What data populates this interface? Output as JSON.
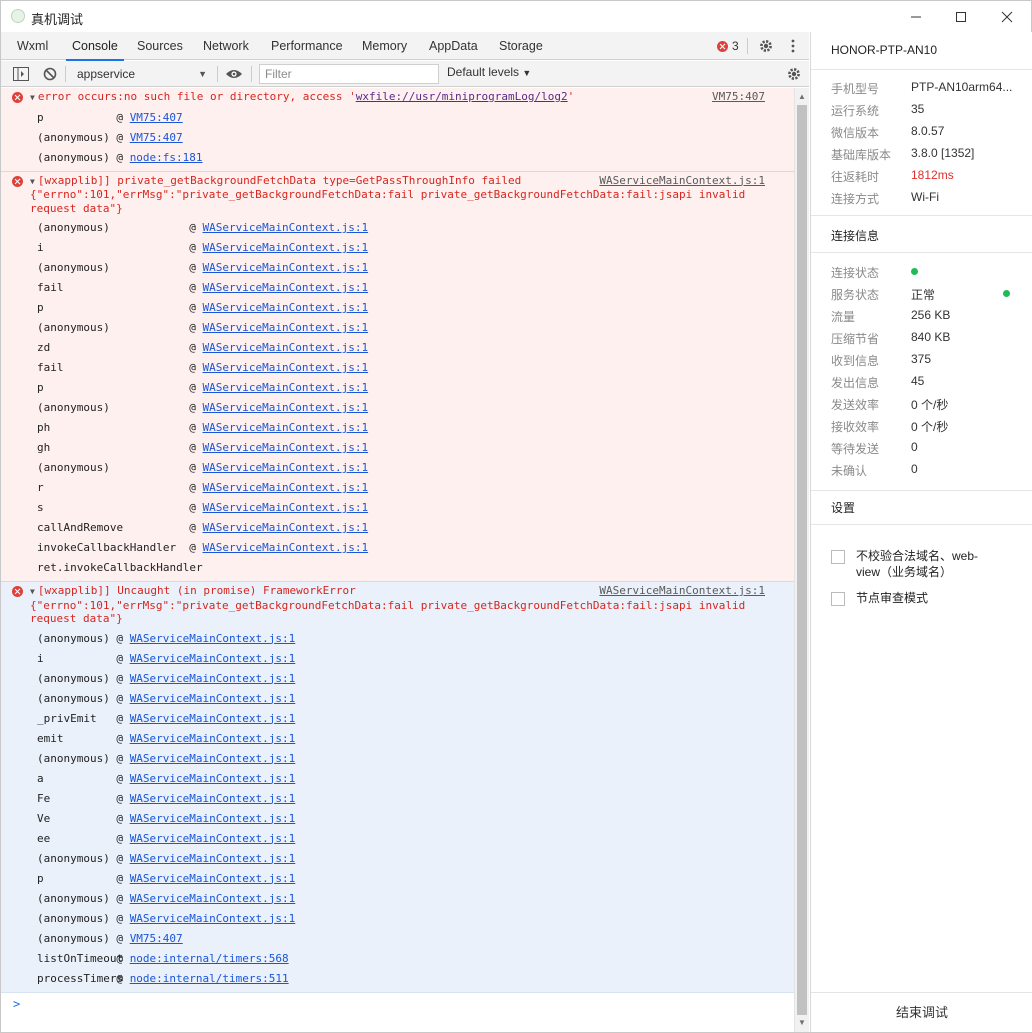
{
  "window": {
    "title": "真机调试"
  },
  "tabs": [
    "Wxml",
    "Console",
    "Sources",
    "Network",
    "Performance",
    "Memory",
    "AppData",
    "Storage"
  ],
  "error_count": "3",
  "toolbar": {
    "context": "appservice",
    "filter_placeholder": "Filter",
    "levels": "Default levels"
  },
  "messages": [
    {
      "type": "error",
      "bg": "red",
      "text_prefix": "error occurs:no such file or directory, access '",
      "text_link": "wxfile://usr/miniprogramLog/log2",
      "text_suffix": "'",
      "source": "VM75:407",
      "frames": [
        {
          "fn": "p",
          "src": "VM75:407"
        },
        {
          "fn": "(anonymous)",
          "src": "VM75:407"
        },
        {
          "fn": "(anonymous)",
          "src": "node:fs:181"
        }
      ]
    },
    {
      "type": "error",
      "bg": "red",
      "text": "[wxapplib]] private_getBackgroundFetchData type=GetPassThroughInfo failed\n{\"errno\":101,\"errMsg\":\"private_getBackgroundFetchData:fail private_getBackgroundFetchData:fail:jsapi invalid\nrequest data\"}",
      "source": "WAServiceMainContext.js:1",
      "frames": [
        {
          "fn": "(anonymous)",
          "src": "WAServiceMainContext.js:1"
        },
        {
          "fn": "i",
          "src": "WAServiceMainContext.js:1"
        },
        {
          "fn": "(anonymous)",
          "src": "WAServiceMainContext.js:1"
        },
        {
          "fn": "fail",
          "src": "WAServiceMainContext.js:1"
        },
        {
          "fn": "p",
          "src": "WAServiceMainContext.js:1"
        },
        {
          "fn": "(anonymous)",
          "src": "WAServiceMainContext.js:1"
        },
        {
          "fn": "zd",
          "src": "WAServiceMainContext.js:1"
        },
        {
          "fn": "fail",
          "src": "WAServiceMainContext.js:1"
        },
        {
          "fn": "p",
          "src": "WAServiceMainContext.js:1"
        },
        {
          "fn": "(anonymous)",
          "src": "WAServiceMainContext.js:1"
        },
        {
          "fn": "ph",
          "src": "WAServiceMainContext.js:1"
        },
        {
          "fn": "gh",
          "src": "WAServiceMainContext.js:1"
        },
        {
          "fn": "(anonymous)",
          "src": "WAServiceMainContext.js:1"
        },
        {
          "fn": "r",
          "src": "WAServiceMainContext.js:1"
        },
        {
          "fn": "s",
          "src": "WAServiceMainContext.js:1"
        },
        {
          "fn": "callAndRemove",
          "src": "WAServiceMainContext.js:1"
        },
        {
          "fn": "invokeCallbackHandler",
          "src": "WAServiceMainContext.js:1"
        },
        {
          "fn": "ret.invokeCallbackHandler",
          "src": ""
        }
      ]
    },
    {
      "type": "error",
      "bg": "blue",
      "text": "[wxapplib]] Uncaught (in promise) FrameworkError\n{\"errno\":101,\"errMsg\":\"private_getBackgroundFetchData:fail private_getBackgroundFetchData:fail:jsapi invalid\nrequest data\"}",
      "source": "WAServiceMainContext.js:1",
      "frames": [
        {
          "fn": "(anonymous)",
          "src": "WAServiceMainContext.js:1"
        },
        {
          "fn": "i",
          "src": "WAServiceMainContext.js:1"
        },
        {
          "fn": "(anonymous)",
          "src": "WAServiceMainContext.js:1"
        },
        {
          "fn": "(anonymous)",
          "src": "WAServiceMainContext.js:1"
        },
        {
          "fn": "_privEmit",
          "src": "WAServiceMainContext.js:1"
        },
        {
          "fn": "emit",
          "src": "WAServiceMainContext.js:1"
        },
        {
          "fn": "(anonymous)",
          "src": "WAServiceMainContext.js:1"
        },
        {
          "fn": "a",
          "src": "WAServiceMainContext.js:1"
        },
        {
          "fn": "Fe",
          "src": "WAServiceMainContext.js:1"
        },
        {
          "fn": "Ve",
          "src": "WAServiceMainContext.js:1"
        },
        {
          "fn": "ee",
          "src": "WAServiceMainContext.js:1"
        },
        {
          "fn": "(anonymous)",
          "src": "WAServiceMainContext.js:1"
        },
        {
          "fn": "p",
          "src": "WAServiceMainContext.js:1"
        },
        {
          "fn": "(anonymous)",
          "src": "WAServiceMainContext.js:1"
        },
        {
          "fn": "(anonymous)",
          "src": "WAServiceMainContext.js:1"
        },
        {
          "fn": "(anonymous)",
          "src": "VM75:407"
        },
        {
          "fn": "listOnTimeout",
          "src": "node:internal/timers:568"
        },
        {
          "fn": "processTimers",
          "src": "node:internal/timers:511"
        }
      ]
    }
  ],
  "prompt": ">",
  "panel": {
    "device_name": "HONOR-PTP-AN10",
    "device_info": [
      {
        "k": "手机型号",
        "v": "PTP-AN10arm64..."
      },
      {
        "k": "运行系统",
        "v": "35"
      },
      {
        "k": "微信版本",
        "v": "8.0.57"
      },
      {
        "k": "基础库版本",
        "v": "3.8.0 [1352]"
      },
      {
        "k": "往返耗时",
        "v": "1812ms"
      },
      {
        "k": "连接方式",
        "v": "Wi-Fi"
      }
    ],
    "conn_title": "连接信息",
    "conn_info": [
      {
        "k": "连接状态",
        "v": ""
      },
      {
        "k": "服务状态",
        "v": "正常"
      },
      {
        "k": "流量",
        "v": "256 KB"
      },
      {
        "k": "压缩节省",
        "v": "840 KB"
      },
      {
        "k": "收到信息",
        "v": "375"
      },
      {
        "k": "发出信息",
        "v": "45"
      },
      {
        "k": "发送效率",
        "v": "0 个/秒"
      },
      {
        "k": "接收效率",
        "v": "0 个/秒"
      },
      {
        "k": "等待发送",
        "v": "0"
      },
      {
        "k": "未确认",
        "v": "0"
      }
    ],
    "settings_title": "设置",
    "settings": [
      {
        "label": "不校验合法域名、web-\nview（业务域名）"
      },
      {
        "label": "节点审查模式"
      }
    ],
    "end_button": "结束调试"
  },
  "colors": {
    "accent": "#1a73e8",
    "error": "#d7261e",
    "status_green": "#1cbd55",
    "latency_red": "#e0302a"
  }
}
